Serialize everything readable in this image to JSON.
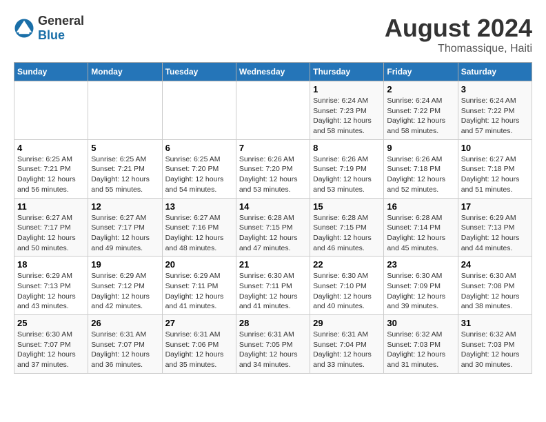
{
  "header": {
    "logo_general": "General",
    "logo_blue": "Blue",
    "month_year": "August 2024",
    "location": "Thomassique, Haiti"
  },
  "days_of_week": [
    "Sunday",
    "Monday",
    "Tuesday",
    "Wednesday",
    "Thursday",
    "Friday",
    "Saturday"
  ],
  "weeks": [
    [
      {
        "day": "",
        "info": ""
      },
      {
        "day": "",
        "info": ""
      },
      {
        "day": "",
        "info": ""
      },
      {
        "day": "",
        "info": ""
      },
      {
        "day": "1",
        "info": "Sunrise: 6:24 AM\nSunset: 7:23 PM\nDaylight: 12 hours\nand 58 minutes."
      },
      {
        "day": "2",
        "info": "Sunrise: 6:24 AM\nSunset: 7:22 PM\nDaylight: 12 hours\nand 58 minutes."
      },
      {
        "day": "3",
        "info": "Sunrise: 6:24 AM\nSunset: 7:22 PM\nDaylight: 12 hours\nand 57 minutes."
      }
    ],
    [
      {
        "day": "4",
        "info": "Sunrise: 6:25 AM\nSunset: 7:21 PM\nDaylight: 12 hours\nand 56 minutes."
      },
      {
        "day": "5",
        "info": "Sunrise: 6:25 AM\nSunset: 7:21 PM\nDaylight: 12 hours\nand 55 minutes."
      },
      {
        "day": "6",
        "info": "Sunrise: 6:25 AM\nSunset: 7:20 PM\nDaylight: 12 hours\nand 54 minutes."
      },
      {
        "day": "7",
        "info": "Sunrise: 6:26 AM\nSunset: 7:20 PM\nDaylight: 12 hours\nand 53 minutes."
      },
      {
        "day": "8",
        "info": "Sunrise: 6:26 AM\nSunset: 7:19 PM\nDaylight: 12 hours\nand 53 minutes."
      },
      {
        "day": "9",
        "info": "Sunrise: 6:26 AM\nSunset: 7:18 PM\nDaylight: 12 hours\nand 52 minutes."
      },
      {
        "day": "10",
        "info": "Sunrise: 6:27 AM\nSunset: 7:18 PM\nDaylight: 12 hours\nand 51 minutes."
      }
    ],
    [
      {
        "day": "11",
        "info": "Sunrise: 6:27 AM\nSunset: 7:17 PM\nDaylight: 12 hours\nand 50 minutes."
      },
      {
        "day": "12",
        "info": "Sunrise: 6:27 AM\nSunset: 7:17 PM\nDaylight: 12 hours\nand 49 minutes."
      },
      {
        "day": "13",
        "info": "Sunrise: 6:27 AM\nSunset: 7:16 PM\nDaylight: 12 hours\nand 48 minutes."
      },
      {
        "day": "14",
        "info": "Sunrise: 6:28 AM\nSunset: 7:15 PM\nDaylight: 12 hours\nand 47 minutes."
      },
      {
        "day": "15",
        "info": "Sunrise: 6:28 AM\nSunset: 7:15 PM\nDaylight: 12 hours\nand 46 minutes."
      },
      {
        "day": "16",
        "info": "Sunrise: 6:28 AM\nSunset: 7:14 PM\nDaylight: 12 hours\nand 45 minutes."
      },
      {
        "day": "17",
        "info": "Sunrise: 6:29 AM\nSunset: 7:13 PM\nDaylight: 12 hours\nand 44 minutes."
      }
    ],
    [
      {
        "day": "18",
        "info": "Sunrise: 6:29 AM\nSunset: 7:13 PM\nDaylight: 12 hours\nand 43 minutes."
      },
      {
        "day": "19",
        "info": "Sunrise: 6:29 AM\nSunset: 7:12 PM\nDaylight: 12 hours\nand 42 minutes."
      },
      {
        "day": "20",
        "info": "Sunrise: 6:29 AM\nSunset: 7:11 PM\nDaylight: 12 hours\nand 41 minutes."
      },
      {
        "day": "21",
        "info": "Sunrise: 6:30 AM\nSunset: 7:11 PM\nDaylight: 12 hours\nand 41 minutes."
      },
      {
        "day": "22",
        "info": "Sunrise: 6:30 AM\nSunset: 7:10 PM\nDaylight: 12 hours\nand 40 minutes."
      },
      {
        "day": "23",
        "info": "Sunrise: 6:30 AM\nSunset: 7:09 PM\nDaylight: 12 hours\nand 39 minutes."
      },
      {
        "day": "24",
        "info": "Sunrise: 6:30 AM\nSunset: 7:08 PM\nDaylight: 12 hours\nand 38 minutes."
      }
    ],
    [
      {
        "day": "25",
        "info": "Sunrise: 6:30 AM\nSunset: 7:07 PM\nDaylight: 12 hours\nand 37 minutes."
      },
      {
        "day": "26",
        "info": "Sunrise: 6:31 AM\nSunset: 7:07 PM\nDaylight: 12 hours\nand 36 minutes."
      },
      {
        "day": "27",
        "info": "Sunrise: 6:31 AM\nSunset: 7:06 PM\nDaylight: 12 hours\nand 35 minutes."
      },
      {
        "day": "28",
        "info": "Sunrise: 6:31 AM\nSunset: 7:05 PM\nDaylight: 12 hours\nand 34 minutes."
      },
      {
        "day": "29",
        "info": "Sunrise: 6:31 AM\nSunset: 7:04 PM\nDaylight: 12 hours\nand 33 minutes."
      },
      {
        "day": "30",
        "info": "Sunrise: 6:32 AM\nSunset: 7:03 PM\nDaylight: 12 hours\nand 31 minutes."
      },
      {
        "day": "31",
        "info": "Sunrise: 6:32 AM\nSunset: 7:03 PM\nDaylight: 12 hours\nand 30 minutes."
      }
    ]
  ]
}
